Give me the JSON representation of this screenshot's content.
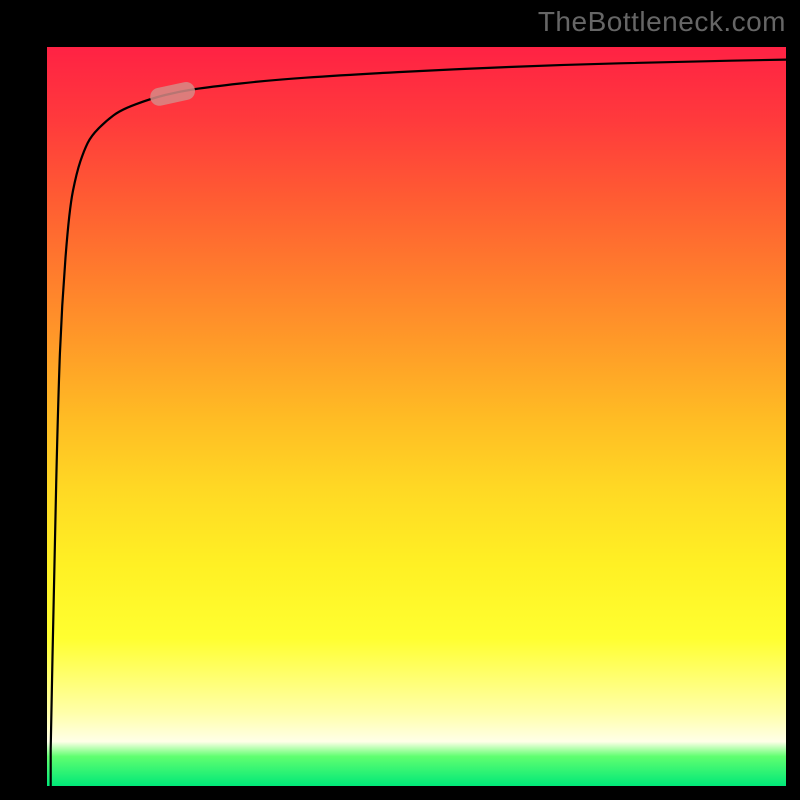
{
  "attribution": "TheBottleneck.com",
  "colors": {
    "frame": "#000000",
    "gradient_top": "#ff2244",
    "gradient_mid": "#ffff30",
    "gradient_bottom": "#00e878",
    "curve": "#000000",
    "highlight_pill": "#d78a86"
  },
  "chart_data": {
    "type": "line",
    "title": "",
    "xlabel": "",
    "ylabel": "",
    "xlim": [
      0,
      100
    ],
    "ylim": [
      0,
      100
    ],
    "x": [
      0.5,
      1,
      1.5,
      2,
      3,
      4,
      5,
      6,
      8,
      10,
      14,
      18,
      22,
      30,
      40,
      55,
      70,
      85,
      100
    ],
    "values": [
      5,
      30,
      52,
      65,
      78,
      83,
      86,
      88,
      90,
      91.5,
      93,
      94,
      94.6,
      95.5,
      96.2,
      97,
      97.6,
      98,
      98.3
    ],
    "series": [
      {
        "name": "curve",
        "x": [
          0.5,
          1,
          1.5,
          2,
          3,
          4,
          5,
          6,
          8,
          10,
          14,
          18,
          22,
          30,
          40,
          55,
          70,
          85,
          100
        ],
        "values": [
          5,
          30,
          52,
          65,
          78,
          83,
          86,
          88,
          90,
          91.5,
          93,
          94,
          94.6,
          95.5,
          96.2,
          97,
          97.6,
          98,
          98.3
        ]
      }
    ],
    "highlight": {
      "x_range": [
        14,
        20
      ],
      "y_range": [
        93,
        94.3
      ]
    },
    "grid": false,
    "legend": false
  }
}
